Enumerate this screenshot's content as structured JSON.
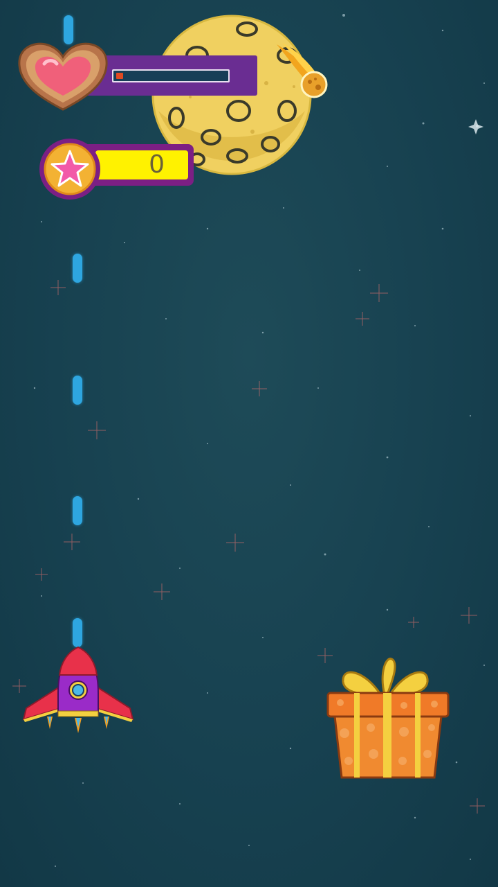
{
  "hud": {
    "health": {
      "level": 0.06,
      "icon": "heart-icon",
      "fill_color": "#e04a22"
    },
    "score": {
      "value": "0",
      "icon": "star-icon"
    }
  },
  "colors": {
    "background": "#174150",
    "laser": "#2ea6e0",
    "score_field": "#fff200",
    "panel": "#6a2d92"
  },
  "sprites": [
    "moon",
    "comet",
    "rocket-ship",
    "gift-box",
    "laser-bolt"
  ]
}
